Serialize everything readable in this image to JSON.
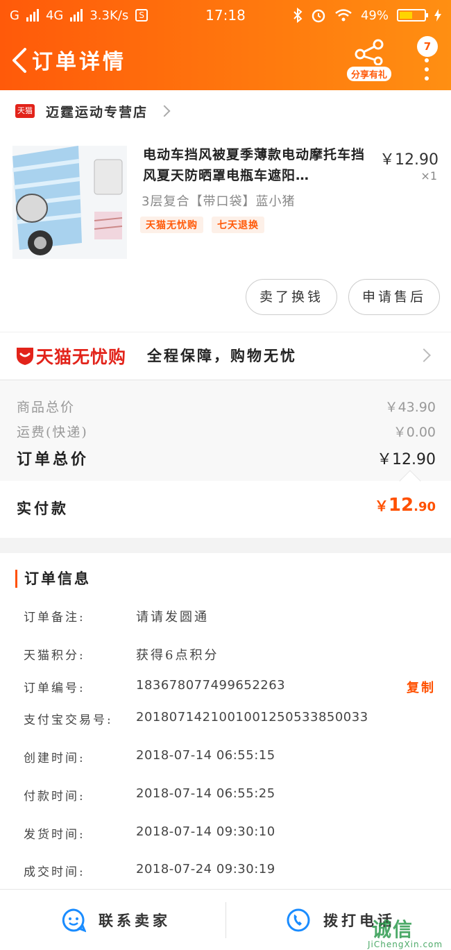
{
  "status_bar": {
    "carrier1": "G",
    "carrier2": "4G",
    "speed": "3.3K/s",
    "sbox": "S",
    "time": "17:18",
    "battery": "49%"
  },
  "nav": {
    "title": "订单详情",
    "share_label": "分享有礼",
    "badge_count": "7"
  },
  "shop": {
    "logo_text": "天猫",
    "name": "迈霆运动专营店"
  },
  "product": {
    "title": "电动车挡风被夏季薄款电动摩托车挡风夏天防晒罩电瓶车遮阳…",
    "price": "￥12.90",
    "qty": "×1",
    "sku": "3层复合【带口袋】蓝小猪",
    "tags": [
      "天猫无忧购",
      "七天退换"
    ]
  },
  "actions": {
    "sell_label": "卖了换钱",
    "after_sales_label": "申请售后"
  },
  "guarantee": {
    "brand": "天猫无忧购",
    "text": "全程保障，购物无忧"
  },
  "summary": {
    "goods_label": "商品总价",
    "goods_value": "￥43.90",
    "shipping_label": "运费(快递)",
    "shipping_value": "￥0.00",
    "total_label": "订单总价",
    "total_value": "￥12.90",
    "paid_label": "实付款",
    "paid_currency": "￥",
    "paid_int": "12",
    "paid_dec": ".90"
  },
  "order_info": {
    "title": "订单信息",
    "rows": [
      {
        "key": "订单备注:",
        "value": "请请发圆通"
      },
      {
        "key": "天猫积分:",
        "value": "获得6点积分"
      },
      {
        "key": "订单编号:",
        "value": "183678077499652263"
      },
      {
        "key": "支付宝交易号:",
        "value": "2018071421001001250533850033"
      },
      {
        "key": "创建时间:",
        "value": "2018-07-14 06:55:15"
      },
      {
        "key": "付款时间:",
        "value": "2018-07-14 06:55:25"
      },
      {
        "key": "发货时间:",
        "value": "2018-07-14 09:30:10"
      },
      {
        "key": "成交时间:",
        "value": "2018-07-24 09:30:19"
      }
    ],
    "copy_label": "复制"
  },
  "bottom_bar": {
    "contact_label": "联系卖家",
    "call_label": "拨打电话"
  },
  "watermark": {
    "logo": "诚信",
    "url": "JiChengXin.com"
  },
  "colors": {
    "accent": "#ff5000",
    "header_start": "#ff5a0a",
    "header_end": "#ff8f12",
    "tmall_red": "#e2231a",
    "icon_blue": "#1a8cff"
  }
}
